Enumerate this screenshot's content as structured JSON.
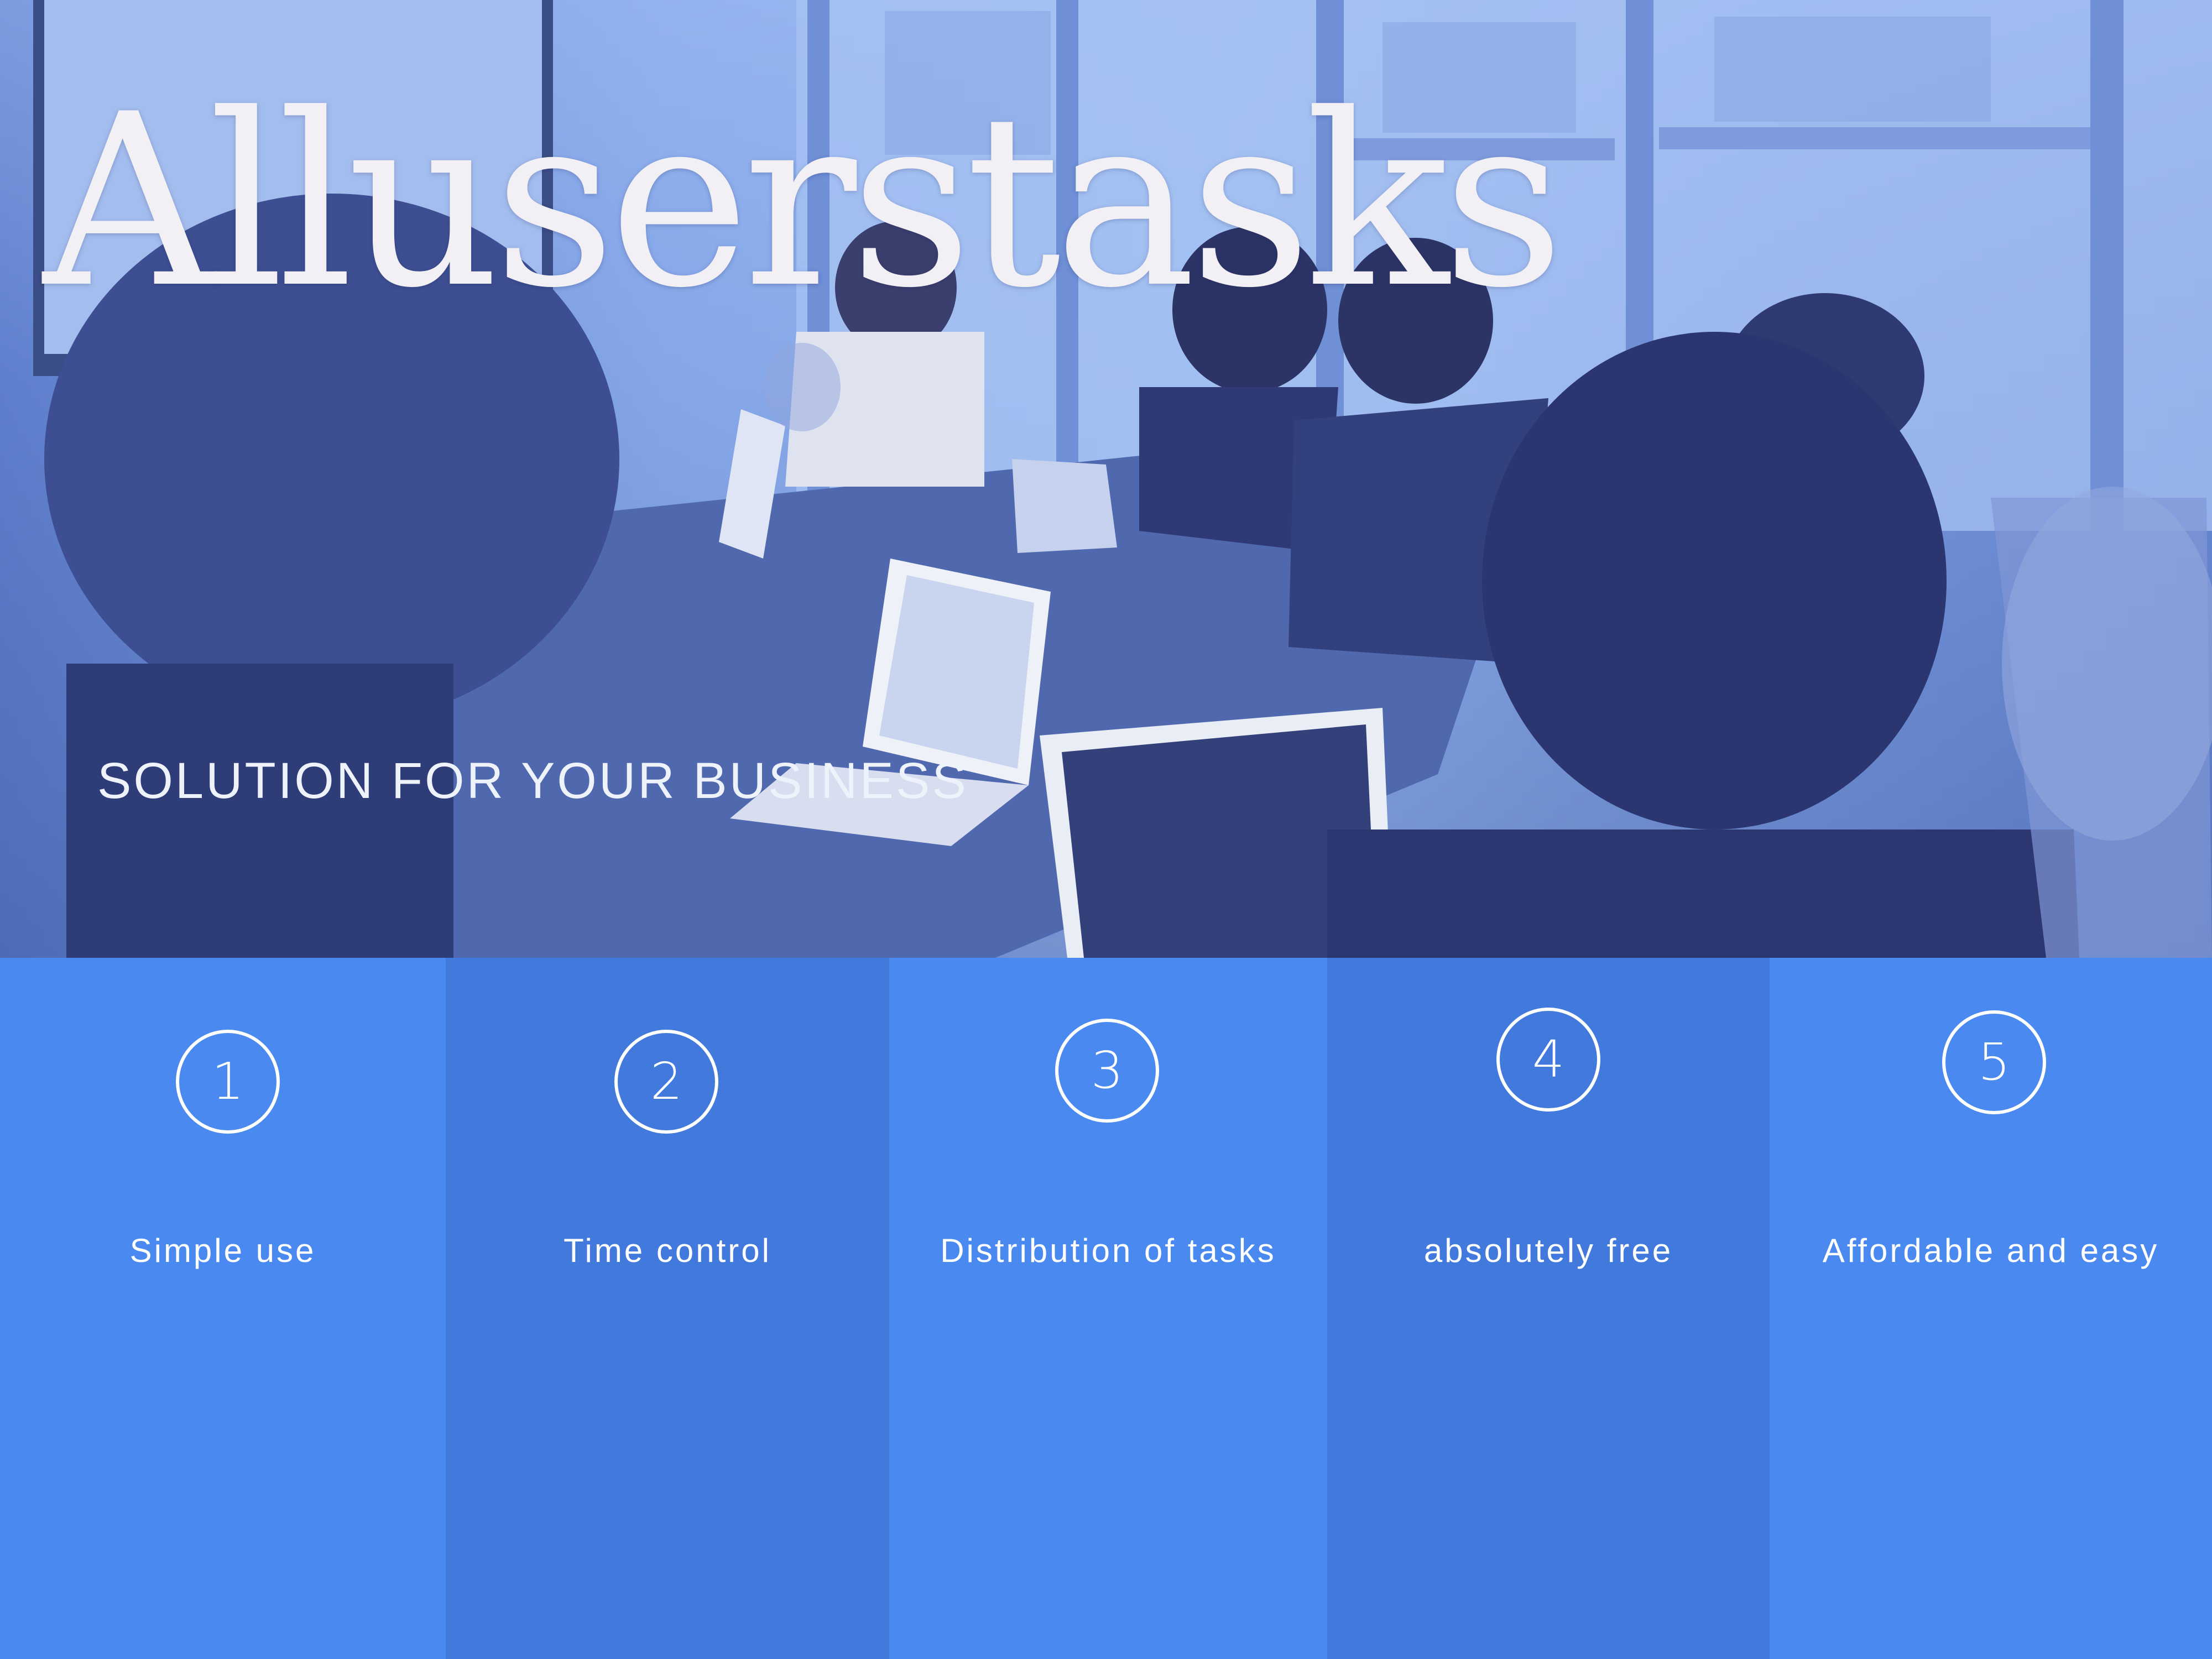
{
  "hero": {
    "title": "Alluserstasks",
    "subtitle": "SOLUTION FOR YOUR BUSINESS"
  },
  "features": [
    {
      "number": "1",
      "label": "Simple use"
    },
    {
      "number": "2",
      "label": "Time control"
    },
    {
      "number": "3",
      "label": "Distribution of tasks"
    },
    {
      "number": "4",
      "label": "absolutely free"
    },
    {
      "number": "5",
      "label": "Affordable and easy"
    }
  ],
  "colors": {
    "feature_light": "#4a89ef",
    "feature_dark": "#4279dc",
    "text": "#ffffff"
  }
}
